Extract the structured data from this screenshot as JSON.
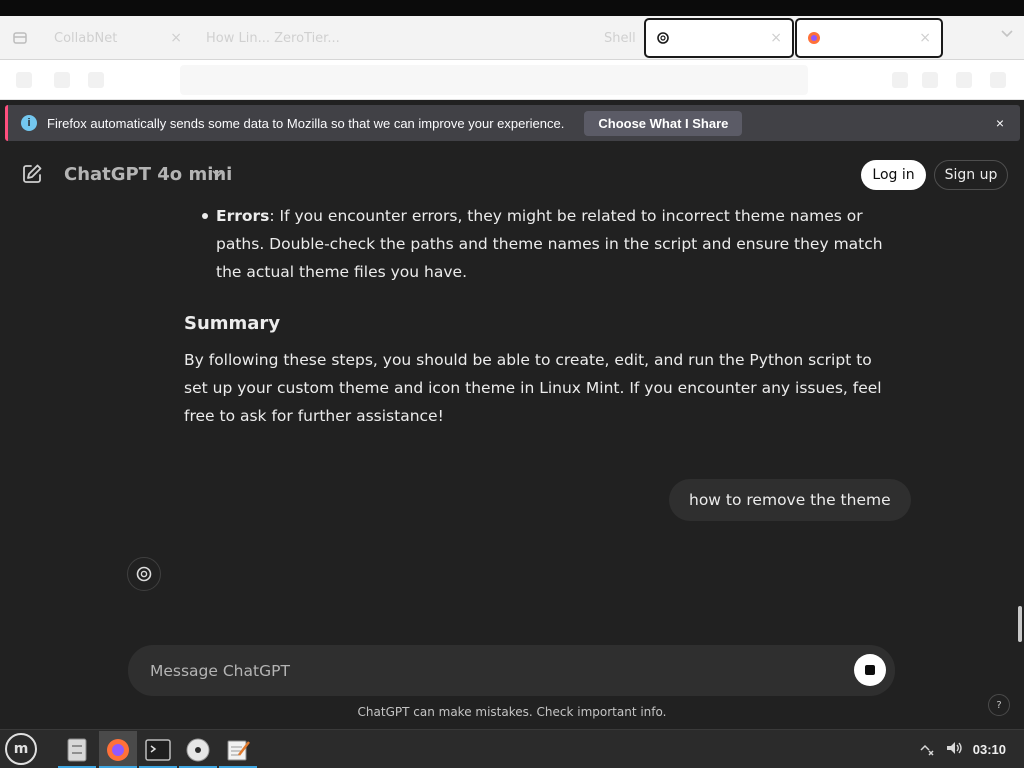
{
  "browser": {
    "tabs": [
      {
        "label": "CollabNet",
        "close": "×"
      },
      {
        "label": "How Lin... ZeroTier...",
        "close": ""
      },
      {
        "label": "Shell",
        "close": ""
      },
      {
        "label": "",
        "close": "×"
      },
      {
        "label": "",
        "close": "×"
      }
    ],
    "overflow_icon": "chevron-down-icon"
  },
  "notification": {
    "message": "Firefox automatically sends some data to Mozilla so that we can improve your experience.",
    "button": "Choose What I Share",
    "close": "×",
    "accent": "#ff4f7e"
  },
  "chat": {
    "model": "ChatGPT 4o mini",
    "login": "Log in",
    "signup": "Sign up",
    "bullet_label": "Errors",
    "bullet_text": ": If you encounter errors, they might be related to incorrect theme names or paths. Double-check the paths and theme names in the script and ensure they match the actual theme files you have.",
    "summary_heading": "Summary",
    "summary_text": "By following these steps, you should be able to create, edit, and run the Python script to set up your custom theme and icon theme in Linux Mint. If you encounter any issues, feel free to ask for further assistance!",
    "user_message": "how to remove the theme",
    "composer_placeholder": "Message ChatGPT",
    "disclaimer": "ChatGPT can make mistakes. Check important info.",
    "help": "?"
  },
  "taskbar": {
    "clock": "03:10",
    "apps": [
      "file-manager-icon",
      "firefox-icon",
      "terminal-icon",
      "disc-icon",
      "text-editor-icon"
    ]
  }
}
